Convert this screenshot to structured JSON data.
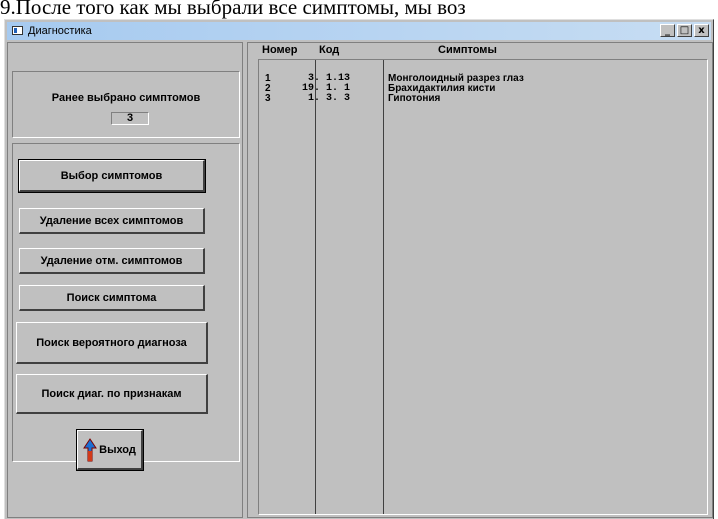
{
  "doc_text": "9.После того как мы выбрали все симптомы, мы воз",
  "window": {
    "title": "Диагностика",
    "buttons": {
      "minimize": "_",
      "maximize": "□",
      "close": "x"
    }
  },
  "left": {
    "prev_label": "Ранее выбрано симптомов",
    "prev_count": "3",
    "buttons": {
      "select": "Выбор симптомов",
      "delete_all": "Удаление всех симптомов",
      "delete_marked": "Удаление отм. симптомов",
      "search_symptom": "Поиск симптома",
      "search_probable": "Поиск вероятного диагноза",
      "search_by_signs": "Поиск диаг. по признакам",
      "exit": "Выход"
    }
  },
  "table": {
    "headers": {
      "num": "Номер",
      "code": "Код",
      "symptoms": "Симптомы"
    },
    "rows": [
      {
        "num": "1",
        "code": " 3. 1.13",
        "symptom": "Монголоидный разрез глаз"
      },
      {
        "num": "2",
        "code": "19. 1. 1",
        "symptom": "Брахидактилия кисти"
      },
      {
        "num": "3",
        "code": " 1. 3. 3",
        "symptom": "Гипотония"
      }
    ]
  },
  "colors": {
    "face": "#c0c0c0",
    "titlebar": "#a6caf0",
    "arrow": "#1b6fd4"
  }
}
